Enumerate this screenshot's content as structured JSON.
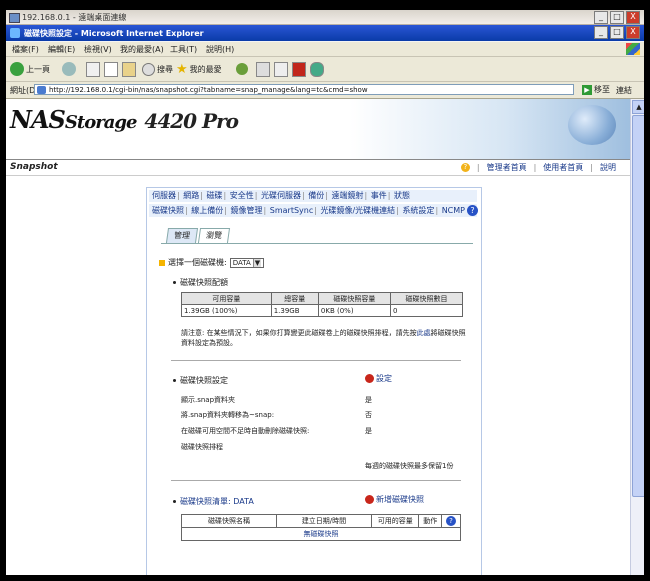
{
  "rdp": {
    "title": "192.168.0.1 - 遠端桌面連線"
  },
  "window": {
    "title": "磁碟快照設定 - Microsoft Internet Explorer",
    "min": "_",
    "max": "□",
    "close": "X"
  },
  "menu": [
    "檔案(F)",
    "編輯(E)",
    "檢視(V)",
    "我的最愛(A)",
    "工具(T)",
    "說明(H)"
  ],
  "toolbar": {
    "back": "上一頁",
    "search": "搜尋",
    "favorites": "我的最愛"
  },
  "address": {
    "label": "網址(D)",
    "url": "http://192.168.0.1/cgi-bin/nas/snapshot.cgi?tabname=snap_manage&lang=tc&cmd=show",
    "go": "移至",
    "links": "連結"
  },
  "app": {
    "brand_prefix": "NAS",
    "brand_suffix": "torage",
    "model": "4420 Pro",
    "section": "Snapshot"
  },
  "toplinks": [
    "管理者首頁",
    "使用者首頁",
    "說明"
  ],
  "nav1": [
    "伺服器",
    "網路",
    "磁碟",
    "安全性",
    "光碟伺服器",
    "備份",
    "遠端鏡射",
    "事件",
    "狀態"
  ],
  "nav2": [
    "磁碟快照",
    "線上備份",
    "鏡像管理",
    "SmartSync",
    "光碟鏡像/光碟機連結",
    "系統設定",
    "NCMP"
  ],
  "tabs": [
    "管理",
    "瀏覽"
  ],
  "volume": {
    "label": "選擇一個磁碟機:",
    "value": "DATA"
  },
  "quota": {
    "title": "磁碟快照配額",
    "headers": [
      "可用容量",
      "總容量",
      "磁碟快照容量",
      "磁碟快照數目"
    ],
    "row": [
      "1.39GB (100%)",
      "1.39GB",
      "0KB (0%)",
      "0"
    ]
  },
  "note": {
    "text": "請注意: 在某些情況下，如果你打算變更此磁碟卷上的磁碟快照排程，請先按",
    "link": "此處",
    "text2": "將磁碟快照資料設定為預設。"
  },
  "settings": {
    "title": "磁碟快照設定",
    "link": "設定",
    "rows": [
      {
        "k": "顯示.snap資料夾",
        "v": "是"
      },
      {
        "k": "將.snap資料夾轉移為~snap:",
        "v": "否"
      },
      {
        "k": "在磁碟可用空間不足時自動刪除磁碟快照:",
        "v": "是"
      },
      {
        "k": "磁碟快照排程",
        "v": ""
      },
      {
        "k": "",
        "v": "每週的磁碟快照最多保留1份"
      }
    ]
  },
  "snaplist": {
    "title": "磁碟快照清單: DATA",
    "link": "新增磁碟快照",
    "headers": [
      "磁碟快照名稱",
      "建立日期/時間",
      "可用的容量",
      "動作"
    ],
    "empty": "無磁碟快照"
  }
}
